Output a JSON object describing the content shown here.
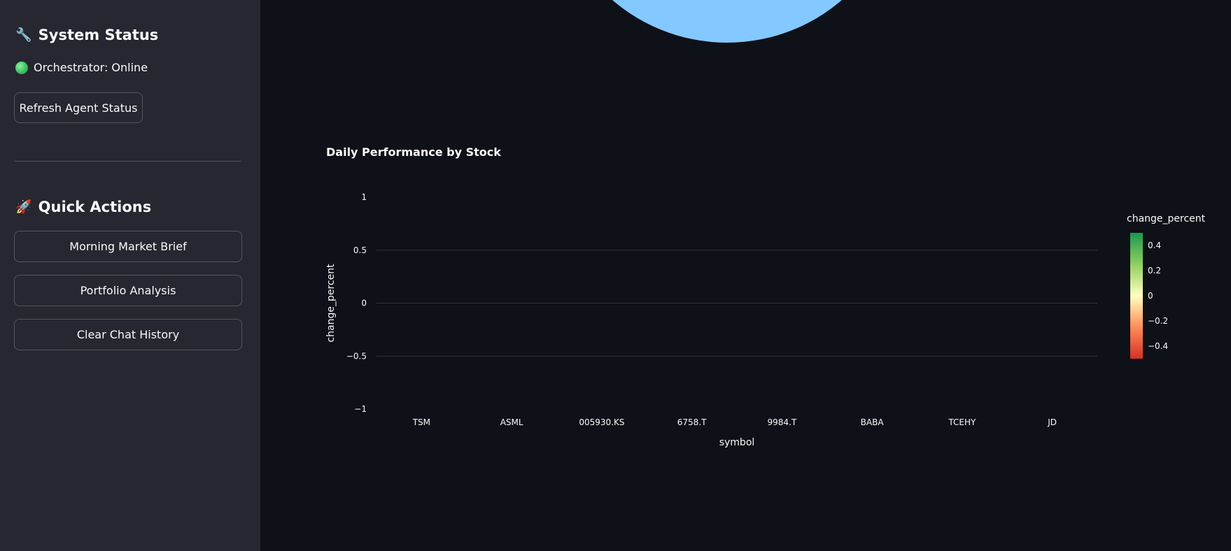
{
  "sidebar": {
    "system_status": {
      "icon": "wrench-icon",
      "title": "System Status",
      "status_text": "Orchestrator: Online",
      "status_color": "#3cc061",
      "refresh_button": "Refresh Agent Status"
    },
    "quick_actions": {
      "icon": "rocket-icon",
      "title": "Quick Actions",
      "buttons": [
        "Morning Market Brief",
        "Portfolio Analysis",
        "Clear Chat History"
      ]
    }
  },
  "main": {
    "pie_color": "#83c9ff",
    "performance_chart": {
      "title": "Daily Performance by Stock"
    }
  },
  "chart_data": {
    "type": "bar",
    "title": "Daily Performance by Stock",
    "xlabel": "symbol",
    "ylabel": "change_percent",
    "categories": [
      "TSM",
      "ASML",
      "005930.KS",
      "6758.T",
      "9984.T",
      "BABA",
      "TCEHY",
      "JD"
    ],
    "values": [
      0,
      0,
      0,
      0,
      0,
      0,
      0,
      0
    ],
    "ylim": [
      -1,
      1
    ],
    "yticks": [
      "1",
      "0.5",
      "0",
      "−0.5",
      "−1"
    ],
    "grid": true,
    "colorbar": {
      "title": "change_percent",
      "ticks": [
        "0.4",
        "0.2",
        "0",
        "−0.2",
        "−0.4"
      ],
      "colors": [
        "#1a9850",
        "#91cf60",
        "#ffffbf",
        "#fc8d59",
        "#d73027"
      ]
    }
  }
}
